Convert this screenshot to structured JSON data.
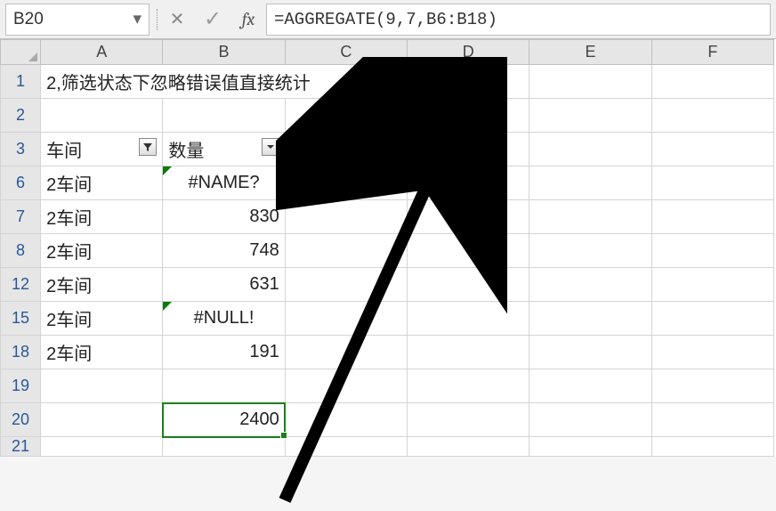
{
  "formula_bar": {
    "name_box": "B20",
    "fx_label": "fx",
    "formula": "=AGGREGATE(9,7,B6:B18)"
  },
  "columns": [
    "A",
    "B",
    "C",
    "D",
    "E",
    "F"
  ],
  "rows": [
    {
      "num": "1",
      "a": "2,筛选状态下忽略错误值直接统计",
      "merge": true
    },
    {
      "num": "2"
    },
    {
      "num": "3",
      "a": "车间",
      "b": "数量",
      "a_filter": "funnel",
      "b_filter": "down"
    },
    {
      "num": "6",
      "a": "2车间",
      "b": "#NAME?",
      "b_err": true,
      "b_align": "center"
    },
    {
      "num": "7",
      "a": "2车间",
      "b": "830",
      "b_align": "right"
    },
    {
      "num": "8",
      "a": "2车间",
      "b": "748",
      "b_align": "right"
    },
    {
      "num": "12",
      "a": "2车间",
      "b": "631",
      "b_align": "right"
    },
    {
      "num": "15",
      "a": "2车间",
      "b": "#NULL!",
      "b_err": true,
      "b_align": "center"
    },
    {
      "num": "18",
      "a": "2车间",
      "b": "191",
      "b_align": "right"
    },
    {
      "num": "19"
    },
    {
      "num": "20",
      "b": "2400",
      "b_align": "right",
      "b_selected": true
    },
    {
      "num": "21",
      "partial": true
    }
  ],
  "chart_data": {
    "type": "table",
    "title": "2,筛选状态下忽略错误值直接统计",
    "columns": [
      "车间",
      "数量"
    ],
    "filtered_rows": [
      {
        "row": 6,
        "车间": "2车间",
        "数量": "#NAME?"
      },
      {
        "row": 7,
        "车间": "2车间",
        "数量": 830
      },
      {
        "row": 8,
        "车间": "2车间",
        "数量": 748
      },
      {
        "row": 12,
        "车间": "2车间",
        "数量": 631
      },
      {
        "row": 15,
        "车间": "2车间",
        "数量": "#NULL!"
      },
      {
        "row": 18,
        "车间": "2车间",
        "数量": 191
      }
    ],
    "result_cell": {
      "ref": "B20",
      "formula": "=AGGREGATE(9,7,B6:B18)",
      "value": 2400
    }
  }
}
